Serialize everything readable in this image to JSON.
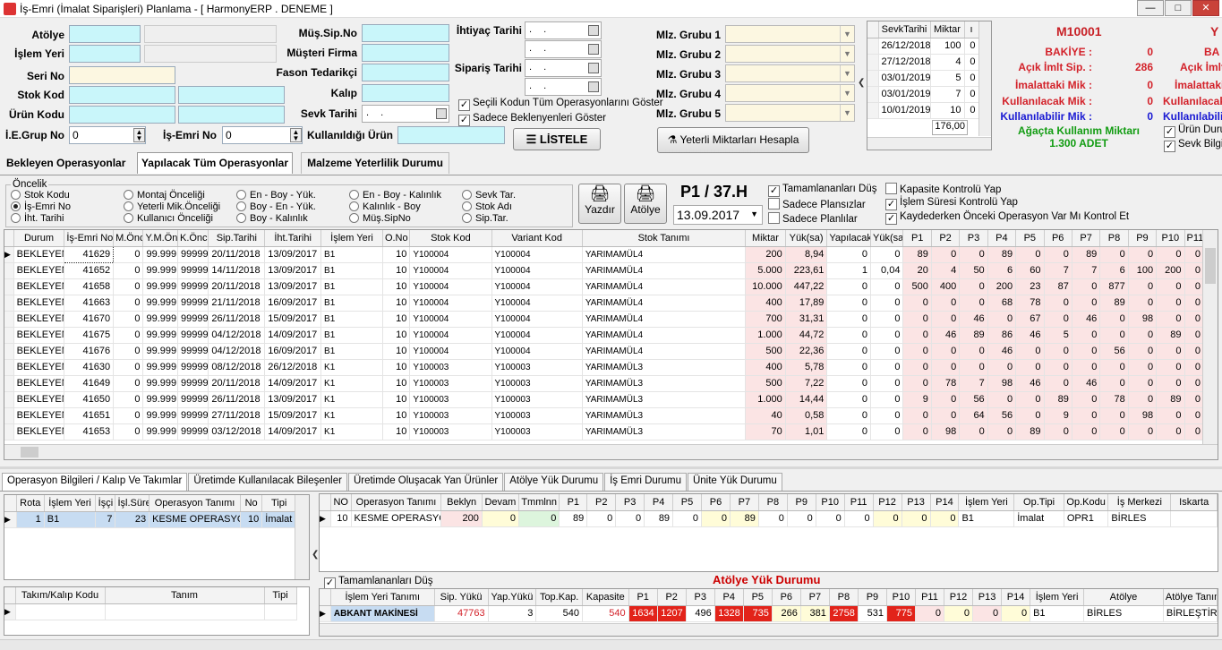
{
  "window": {
    "title": "İş-Emri (İmalat Siparişleri) Planlama - [ HarmonyERP . DENEME ]"
  },
  "form": {
    "atolye_label": "Atölye",
    "islem_yeri_label": "İşlem Yeri",
    "seri_no_label": "Seri No",
    "stok_kod_label": "Stok Kod",
    "urun_kodu_label": "Ürün Kodu",
    "ie_grup_label": "İ.E.Grup No",
    "ie_grup_value": "0",
    "is_emri_label": "İş-Emri No",
    "is_emri_value": "0",
    "mus_sip_label": "Müş.Sip.No",
    "musteri_label": "Müşteri Firma",
    "fason_label": "Fason Tedarikçi",
    "kalip_label": "Kalıp",
    "sevk_tarihi_label": "Sevk Tarihi",
    "sevk_tarihi_value": ". .",
    "kullanildigi_label": "Kullanıldığı Ürün",
    "ihtiyac_label": "İhtiyaç Tarihi",
    "siparis_label": "Sipariş Tarihi",
    "date_empty": ". .",
    "chk_secili": "Seçili Kodun Tüm Operasyonlarını Göster",
    "chk_sadece": "Sadece Beklenyenleri Göster",
    "listele_btn": "LİSTELE",
    "mlz1": "Mlz. Grubu 1",
    "mlz2": "Mlz. Grubu 2",
    "mlz3": "Mlz. Grubu 3",
    "mlz4": "Mlz. Grubu 4",
    "mlz5": "Mlz. Grubu 5",
    "yeterli_btn": "Yeterli Miktarları Hesapla"
  },
  "sevk_grid": {
    "headers": [
      "SevkTarihi",
      "Miktar",
      "ı"
    ],
    "rows": [
      [
        "26/12/2018",
        "100",
        "0"
      ],
      [
        "27/12/2018",
        "4",
        "0"
      ],
      [
        "03/01/2019",
        "5",
        "0"
      ],
      [
        "03/01/2019",
        "7",
        "0"
      ],
      [
        "10/01/2019",
        "10",
        "0"
      ]
    ],
    "total": "176,00"
  },
  "stock_info": {
    "code": "M10001",
    "code2": "Y",
    "bakiye_label": "BAKİYE :",
    "bakiye": "0",
    "acik_label": "Açık İmlt Sip. :",
    "acik": "286",
    "imalat_label": "İmalattaki Mik :",
    "imalat": "0",
    "kullanilacak_label": "Kullanılacak Mik :",
    "kullanilacak": "0",
    "kullanilabilir_label": "Kullanılabilir Mik :",
    "kullanilabilir": "0",
    "agac_label": "Ağaçta Kullanım Miktarı",
    "agac_value": "1.300 ADET",
    "right_bakiye": "BA",
    "right_acik": "Açık İmlt",
    "right_imalat": "İmalattaki",
    "right_kull": "Kullanılacak",
    "right_kullab": "Kullanılabili",
    "chk_urun": "Ürün Duru",
    "chk_sevk": "Sevk Bilgis"
  },
  "main_tabs": [
    "Bekleyen Operasyonlar",
    "Yapılacak Tüm Operasyonlar",
    "Malzeme Yeterlilik Durumu"
  ],
  "oncelik": {
    "title": "Öncelik",
    "col1": [
      "Stok Kodu",
      "İş-Emri No",
      "İht. Tarihi"
    ],
    "col2": [
      "Montaj Önceliği",
      "Yeterli Mik.Önceliği",
      "Kullanıcı Önceliği"
    ],
    "col3": [
      "En - Boy - Yük.",
      "Boy - En - Yük.",
      "Boy - Kalınlık"
    ],
    "col4": [
      "En - Boy - Kalınlık",
      "Kalınlık - Boy",
      "Müş.SipNo"
    ],
    "col5": [
      "Sevk Tar.",
      "Stok Adı",
      "Sip.Tar."
    ]
  },
  "yazdir_btn": "Yazdır",
  "atolye_btn": "Atölye",
  "period": {
    "label": "P1 / 37.H",
    "date": "13.09.2017"
  },
  "options1": [
    "Tamamlananları Düş",
    "Sadece Plansızlar",
    "Sadece Planlılar"
  ],
  "options2": [
    "Kapasite Kontrolü Yap",
    "İşlem Süresi Kontrolü Yap",
    "Kaydederken Önceki Operasyon Var Mı Kontrol Et"
  ],
  "main_grid": {
    "headers": [
      "Durum",
      "İş-Emri No",
      "M.Önc",
      "Y.M.Önc",
      "K.Önc",
      "Sip.Tarihi",
      "İht.Tarihi",
      "İşlem Yeri",
      "O.No",
      "Stok Kod",
      "Variant Kod",
      "Stok Tanımı",
      "Miktar",
      "Yük(sa)",
      "Yapılacak",
      "Yük(sa)",
      "P1",
      "P2",
      "P3",
      "P4",
      "P5",
      "P6",
      "P7",
      "P8",
      "P9",
      "P10",
      "P11"
    ],
    "rows": [
      [
        "BEKLEYEN",
        "41629",
        "0",
        "99.999",
        "99999",
        "20/11/2018",
        "13/09/2017",
        "B1",
        "10",
        "Y100004",
        "Y100004",
        "YARIMAMÜL4",
        "200",
        "8,94",
        "0",
        "0",
        "89",
        "0",
        "0",
        "89",
        "0",
        "0",
        "89",
        "0",
        "0",
        "0",
        "0"
      ],
      [
        "BEKLEYEN",
        "41652",
        "0",
        "99.999",
        "99999",
        "14/11/2018",
        "13/09/2017",
        "B1",
        "10",
        "Y100004",
        "Y100004",
        "YARIMAMÜL4",
        "5.000",
        "223,61",
        "1",
        "0,04",
        "20",
        "4",
        "50",
        "6",
        "60",
        "7",
        "7",
        "6",
        "100",
        "200",
        "0"
      ],
      [
        "BEKLEYEN",
        "41658",
        "0",
        "99.999",
        "99999",
        "20/11/2018",
        "13/09/2017",
        "B1",
        "10",
        "Y100004",
        "Y100004",
        "YARIMAMÜL4",
        "10.000",
        "447,22",
        "0",
        "0",
        "500",
        "400",
        "0",
        "200",
        "23",
        "87",
        "0",
        "877",
        "0",
        "0",
        "0"
      ],
      [
        "BEKLEYEN",
        "41663",
        "0",
        "99.999",
        "99999",
        "21/11/2018",
        "16/09/2017",
        "B1",
        "10",
        "Y100004",
        "Y100004",
        "YARIMAMÜL4",
        "400",
        "17,89",
        "0",
        "0",
        "0",
        "0",
        "0",
        "68",
        "78",
        "0",
        "0",
        "89",
        "0",
        "0",
        "0"
      ],
      [
        "BEKLEYEN",
        "41670",
        "0",
        "99.999",
        "99999",
        "26/11/2018",
        "15/09/2017",
        "B1",
        "10",
        "Y100004",
        "Y100004",
        "YARIMAMÜL4",
        "700",
        "31,31",
        "0",
        "0",
        "0",
        "0",
        "46",
        "0",
        "67",
        "0",
        "46",
        "0",
        "98",
        "0",
        "0"
      ],
      [
        "BEKLEYEN",
        "41675",
        "0",
        "99.999",
        "99999",
        "04/12/2018",
        "14/09/2017",
        "B1",
        "10",
        "Y100004",
        "Y100004",
        "YARIMAMÜL4",
        "1.000",
        "44,72",
        "0",
        "0",
        "0",
        "46",
        "89",
        "86",
        "46",
        "5",
        "0",
        "0",
        "0",
        "89",
        "0"
      ],
      [
        "BEKLEYEN",
        "41676",
        "0",
        "99.999",
        "99999",
        "04/12/2018",
        "16/09/2017",
        "B1",
        "10",
        "Y100004",
        "Y100004",
        "YARIMAMÜL4",
        "500",
        "22,36",
        "0",
        "0",
        "0",
        "0",
        "0",
        "46",
        "0",
        "0",
        "0",
        "56",
        "0",
        "0",
        "0"
      ],
      [
        "BEKLEYEN",
        "41630",
        "0",
        "99.999",
        "99999",
        "08/12/2018",
        "26/12/2018",
        "K1",
        "10",
        "Y100003",
        "Y100003",
        "YARIMAMÜL3",
        "400",
        "5,78",
        "0",
        "0",
        "0",
        "0",
        "0",
        "0",
        "0",
        "0",
        "0",
        "0",
        "0",
        "0",
        "0"
      ],
      [
        "BEKLEYEN",
        "41649",
        "0",
        "99.999",
        "99999",
        "20/11/2018",
        "14/09/2017",
        "K1",
        "10",
        "Y100003",
        "Y100003",
        "YARIMAMÜL3",
        "500",
        "7,22",
        "0",
        "0",
        "0",
        "78",
        "7",
        "98",
        "46",
        "0",
        "46",
        "0",
        "0",
        "0",
        "0"
      ],
      [
        "BEKLEYEN",
        "41650",
        "0",
        "99.999",
        "99999",
        "26/11/2018",
        "13/09/2017",
        "K1",
        "10",
        "Y100003",
        "Y100003",
        "YARIMAMÜL3",
        "1.000",
        "14,44",
        "0",
        "0",
        "9",
        "0",
        "56",
        "0",
        "0",
        "89",
        "0",
        "78",
        "0",
        "89",
        "0"
      ],
      [
        "BEKLEYEN",
        "41651",
        "0",
        "99.999",
        "99999",
        "27/11/2018",
        "15/09/2017",
        "K1",
        "10",
        "Y100003",
        "Y100003",
        "YARIMAMÜL3",
        "40",
        "0,58",
        "0",
        "0",
        "0",
        "0",
        "64",
        "56",
        "0",
        "9",
        "0",
        "0",
        "98",
        "0",
        "0"
      ],
      [
        "BEKLEYEN",
        "41653",
        "0",
        "99.999",
        "99999",
        "03/12/2018",
        "14/09/2017",
        "K1",
        "10",
        "Y100003",
        "Y100003",
        "YARIMAMÜL3",
        "70",
        "1,01",
        "0",
        "0",
        "0",
        "98",
        "0",
        "0",
        "89",
        "0",
        "0",
        "0",
        "0",
        "0",
        "0"
      ]
    ]
  },
  "bottom_tabs": [
    "Operasyon Bilgileri / Kalıp Ve Takımlar",
    "Üretimde Kullanılacak Bileşenler",
    "Üretimde Oluşacak Yan Ürünler",
    "Atölye Yük Durumu",
    "İş Emri Durumu",
    "Ünite Yük Durumu"
  ],
  "rota_grid": {
    "headers": [
      "Rota",
      "İşlem Yeri",
      "İşçi",
      "İşl.Süre",
      "Operasyon Tanımı",
      "No",
      "Tipi"
    ],
    "rows": [
      [
        "1",
        "B1",
        "7",
        "23",
        "KESME OPERASYO",
        "10",
        "İmalat"
      ]
    ]
  },
  "takim_grid": {
    "headers": [
      "Takım/Kalıp Kodu",
      "Tanım",
      "Tipi"
    ]
  },
  "op_grid": {
    "headers": [
      "NO",
      "Operasyon Tanımı",
      "Beklyn",
      "Devam",
      "Tmmlnn",
      "P1",
      "P2",
      "P3",
      "P4",
      "P5",
      "P6",
      "P7",
      "P8",
      "P9",
      "P10",
      "P11",
      "P12",
      "P13",
      "P14",
      "İşlem Yeri",
      "Op.Tipi",
      "Op.Kodu",
      "İş Merkezi",
      "Iskarta"
    ],
    "rows": [
      [
        "10",
        "KESME OPERASYOI",
        "200",
        "0",
        "0",
        "89",
        "0",
        "0",
        "89",
        "0",
        "0",
        "89",
        "0",
        "0",
        "0",
        "0",
        "0",
        "0",
        "0",
        "B1",
        "İmalat",
        "OPR1",
        "BİRLES",
        ""
      ]
    ]
  },
  "atolye_yuk": {
    "chk": "Tamamlananları Düş",
    "title": "Atölye Yük Durumu",
    "headers": [
      "İşlem Yeri Tanımı",
      "Sip. Yükü",
      "Yap.Yükü",
      "Top.Kap.",
      "Kapasite",
      "P1",
      "P2",
      "P3",
      "P4",
      "P5",
      "P6",
      "P7",
      "P8",
      "P9",
      "P10",
      "P11",
      "P12",
      "P13",
      "P14",
      "İşlem Yeri",
      "Atölye",
      "Atölye Tanım"
    ],
    "rows": [
      [
        "ABKANT MAKİNESİ",
        "47763",
        "3",
        "540",
        "540",
        "1634",
        "1207",
        "496",
        "1328",
        "735",
        "266",
        "381",
        "2758",
        "531",
        "775",
        "0",
        "0",
        "0",
        "0",
        "B1",
        "BİRLES",
        "BİRLEŞTİRMİ"
      ]
    ]
  }
}
